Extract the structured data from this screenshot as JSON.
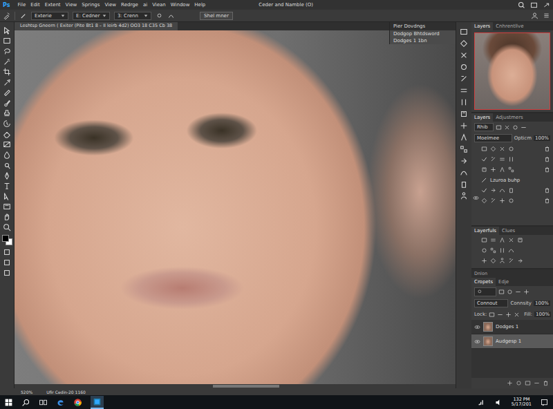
{
  "app": {
    "logo": "Ps",
    "title": "Ceder and Namble (O)"
  },
  "menu": [
    "File",
    "Edit",
    "Extent",
    "View",
    "Springs",
    "View",
    "Redrge",
    "ai",
    "Viean",
    "Window",
    "Help"
  ],
  "options_bar": {
    "fields": [
      {
        "label": "Exterie"
      },
      {
        "label": "E: Cedner"
      },
      {
        "label": "3: Crenn"
      }
    ],
    "button": "Shel mner"
  },
  "document_tab": {
    "title": "Leshtsp Gneern ( Exiter (Pite Bt1 8 – II leirb 4d2) OO3 18 C35 Cb 38"
  },
  "floating_panel": {
    "title": "Pier Dovdngs",
    "rows": [
      {
        "label": "Dodgop Bhtdsword",
        "selected": true
      },
      {
        "label": "Dodges 1 1bn",
        "selected": true
      }
    ]
  },
  "panels": {
    "navigator": {
      "tabs": [
        {
          "label": "Layers",
          "selected": true
        },
        {
          "label": "Cnhrentllve",
          "selected": false
        }
      ]
    },
    "adjustments": {
      "tabs": [
        {
          "label": "Layers",
          "selected": true
        },
        {
          "label": "Adjustmers",
          "selected": false
        }
      ],
      "kind_filter": "Rhib",
      "blend": "Moelmee",
      "opacity_label": "Opticm",
      "opacity": "100%",
      "layer": {
        "name": "Lzuroa buhp",
        "visible": true
      }
    },
    "styles": {
      "tabs": [
        {
          "label": "Layerfuls",
          "selected": true
        },
        {
          "label": "Clues",
          "selected": false
        }
      ]
    },
    "layers": {
      "header": "Dnlon",
      "tabs": [
        {
          "label": "Cropets",
          "selected": true
        },
        {
          "label": "Edje",
          "selected": false
        }
      ],
      "blend": "Connout",
      "opacity_label": "Connsity",
      "opacity": "100%",
      "lock_label": "Lock:",
      "fill_label": "Fill:",
      "fill": "100%",
      "items": [
        {
          "name": "Dodges 1",
          "visible": true,
          "selected": false
        },
        {
          "name": "Audgesp 1",
          "visible": true,
          "selected": true
        }
      ]
    }
  },
  "status_bar": {
    "zoom": "520%",
    "info": "Ufir Cedin-20 1160"
  },
  "taskbar": {
    "time": "132 PM",
    "date": "5/17/201"
  }
}
